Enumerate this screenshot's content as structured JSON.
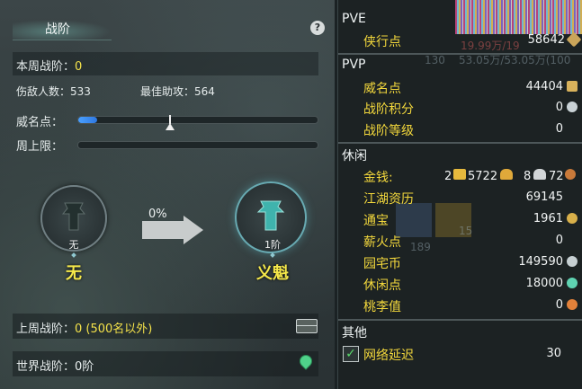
{
  "left": {
    "title": "战阶",
    "help": "?",
    "weekly_rank_label": "本周战阶：",
    "weekly_rank_value": "0",
    "injured_label": "伤敌人数：533",
    "best_assist_label": "最佳助攻：564",
    "reputation_label": "威名点：",
    "reputation_progress": 0.08,
    "weekly_cap_label": "周上限：",
    "weekly_cap_progress": 0,
    "current_rank": {
      "badge": "无",
      "name": "无"
    },
    "progress_pct": "0%",
    "next_rank": {
      "badge": "1阶",
      "name": "义魁"
    },
    "last_week_label": "上周战阶：",
    "last_week_value": "0 (500名以外)",
    "world_rank_label": "世界战阶：0阶"
  },
  "right": {
    "pve_header": "PVE",
    "pve_rows": [
      {
        "label": "侠行点",
        "value": "58642"
      }
    ],
    "pvp_header": "PVP",
    "pvp_rows": [
      {
        "label": "威名点",
        "value": "44404"
      },
      {
        "label": "战阶积分",
        "value": "0"
      },
      {
        "label": "战阶等级",
        "value": "0"
      }
    ],
    "leisure_header": "休闲",
    "money_label": "金钱:",
    "money": {
      "gold": "2",
      "silver": "5722",
      "copper_a": "8",
      "copper_b": "72"
    },
    "leisure_rows": [
      {
        "label": "江湖资历",
        "value": "69145"
      },
      {
        "label": "通宝",
        "value": "1961"
      },
      {
        "label": "薪火点",
        "value": "0"
      },
      {
        "label": "园宅币",
        "value": "149590"
      },
      {
        "label": "休闲点",
        "value": "18000"
      },
      {
        "label": "桃李值",
        "value": "0"
      }
    ],
    "other_header": "其他",
    "latency_label": "网络延迟",
    "latency_value": "30",
    "bg_ghost_1": "19.99万/19",
    "bg_ghost_2": "53.05万/53.05万(100",
    "bg_ghost_3": "130",
    "bg_ghost_4": "189",
    "bg_ghost_5": "15"
  },
  "colors": {
    "accent": "#f3d83c",
    "value_yellow": "#f5e84a",
    "bar_blue": "#3a8ef0"
  }
}
